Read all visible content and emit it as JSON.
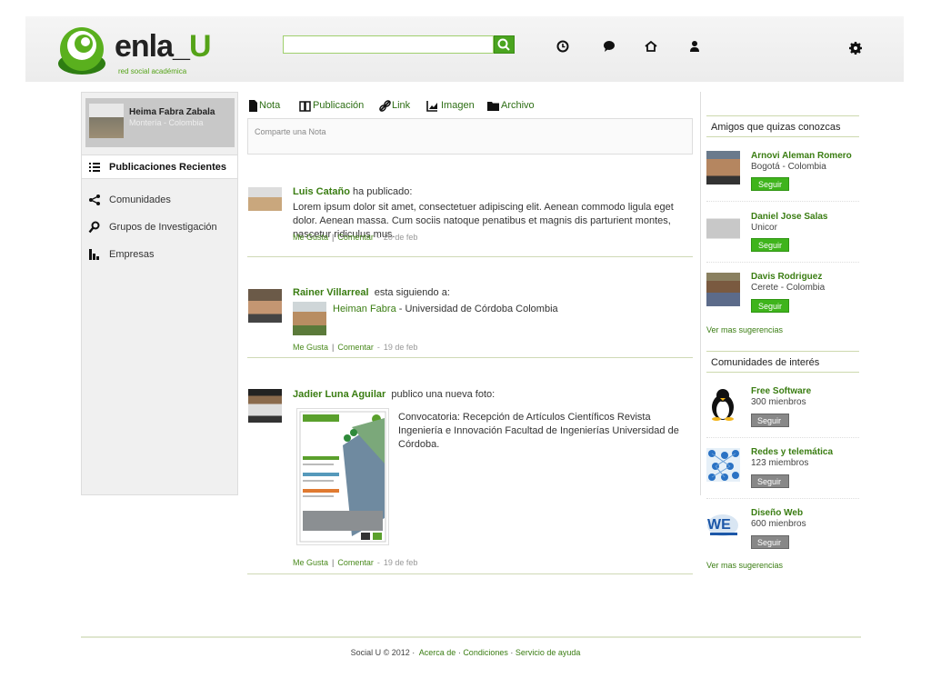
{
  "header": {
    "logo_text": "enla_",
    "logo_u": "U",
    "logo_tagline": "red social académica",
    "search_placeholder": ""
  },
  "profile": {
    "name": "Heima Fabra Zabala",
    "location": "Montería - Colombia"
  },
  "nav": {
    "recent": "Publicaciones Recientes",
    "communities": "Comunidades",
    "groups": "Grupos de Investigación",
    "companies": "Empresas"
  },
  "tabs": {
    "note": "Nota",
    "post": "Publicación",
    "link": "Link",
    "image": "Imagen",
    "file": "Archivo"
  },
  "composer": {
    "placeholder": "Comparte una Nota"
  },
  "posts": [
    {
      "author": "Luis Cataño",
      "action": "ha publicado:",
      "text": "Lorem ipsum dolor sit amet, consectetuer adipiscing elit. Aenean commodo ligula eget dolor. Aenean massa. Cum sociis natoque penatibus et magnis dis parturient montes, nascetur ridiculus mus.",
      "like": "Me Gusta",
      "comment": "Comentar",
      "date": "20 de feb"
    },
    {
      "author": "Rainer Villarreal",
      "action": "esta siguiendo a:",
      "followed_name": "Heiman Fabra",
      "followed_info": " - Universidad de Córdoba Colombia",
      "like": "Me Gusta",
      "comment": "Comentar",
      "date": "19 de feb"
    },
    {
      "author": "Jadier Luna Aguilar",
      "action": "publico una nueva foto:",
      "caption": "Convocatoria: Recepción de Artículos Científicos Revista Ingeniería e Innovación Facultad de Ingenierías Universidad de Córdoba.",
      "like": "Me Gusta",
      "comment": "Comentar",
      "date": "19 de feb"
    }
  ],
  "suggestions": {
    "title": "Amigos que quizas conozcas",
    "items": [
      {
        "name": "Arnovi Aleman Romero",
        "sub": "Bogotá - Colombia",
        "button": "Seguir"
      },
      {
        "name": "Daniel Jose Salas",
        "sub": "Unicor",
        "button": "Seguir"
      },
      {
        "name": "Davis Rodriguez",
        "sub": "Cerete  - Colombia",
        "button": "Seguir"
      }
    ],
    "more": "Ver mas sugerencias"
  },
  "communities": {
    "title": "Comunidades de interés",
    "items": [
      {
        "name": "Free Software",
        "sub": "300 mienbros",
        "button": "Seguir"
      },
      {
        "name": "Redes y telemática",
        "sub": "123 miembros",
        "button": "Seguir"
      },
      {
        "name": "Diseño Web",
        "sub": "600 mienbros",
        "button": "Seguir"
      }
    ],
    "more": "Ver mas sugerencias"
  },
  "footer": {
    "copyright": "Social U © 2012 ·",
    "about": "Acerca de",
    "conditions": "Condiciones",
    "help": "Servicio de ayuda"
  },
  "colors": {
    "accent": "#55a318",
    "link": "#3a7d12",
    "button": "#3fb41c"
  }
}
